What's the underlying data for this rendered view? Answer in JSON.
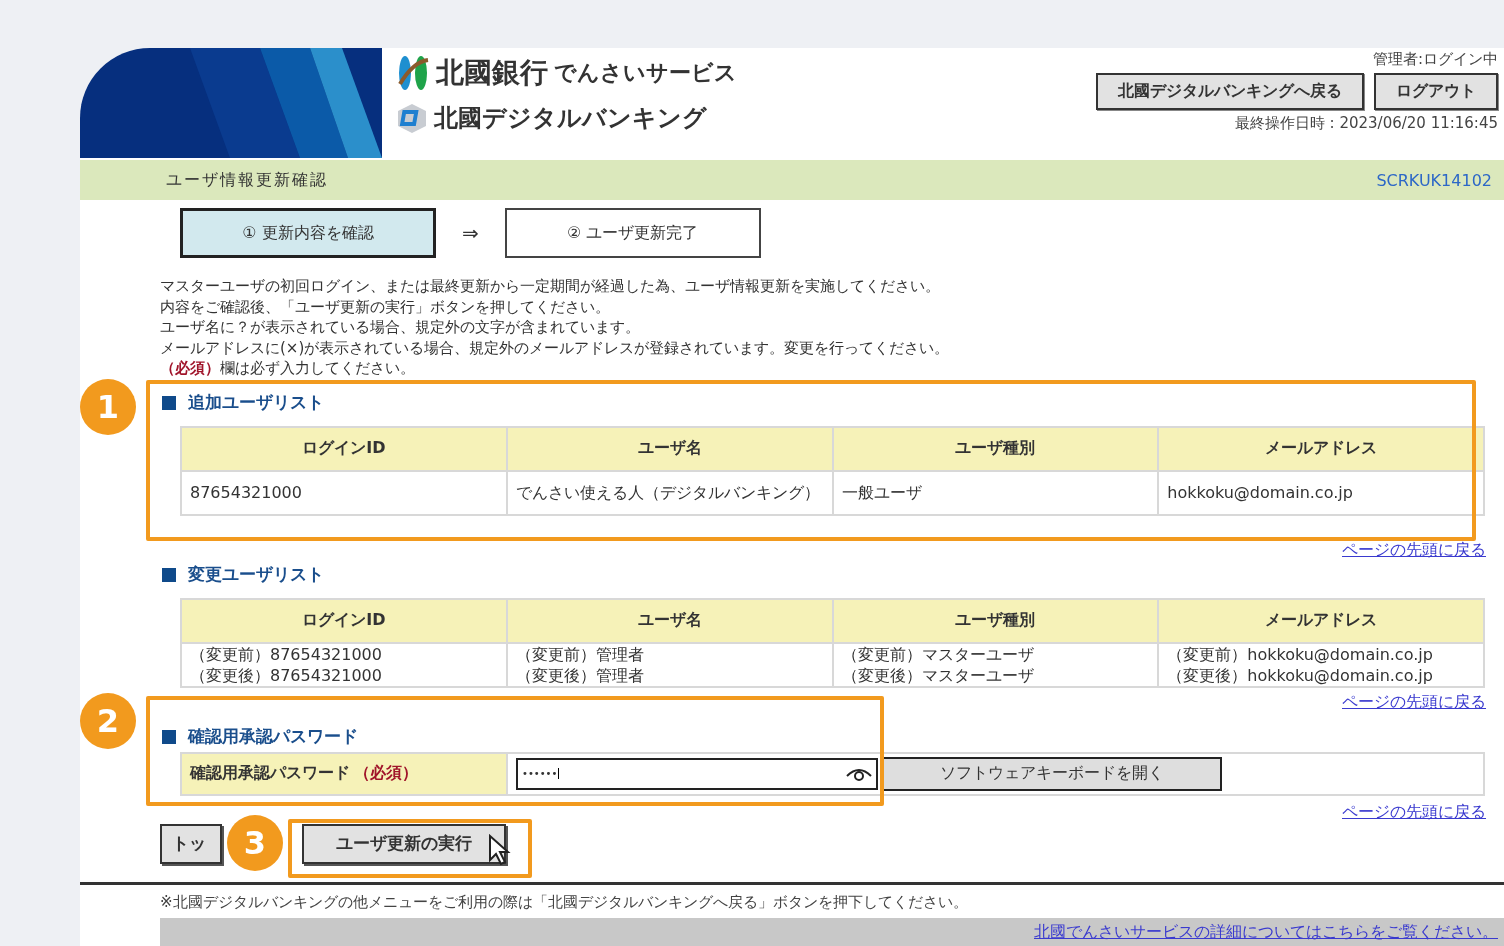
{
  "header": {
    "brand_name": "北國銀行",
    "service_name": "でんさいサービス",
    "sub_brand": "北國デジタルバンキング",
    "login_status": "管理者:ログイン中",
    "buttons": [
      "北國デジタルバンキングへ戻る",
      "ログアウト"
    ],
    "last_operation": "最終操作日時 : 2023/06/20 11:16:45"
  },
  "page_bar": {
    "title": "ユーザ情報更新確認",
    "screen_id": "SCRKUK14102"
  },
  "steps": [
    {
      "label": "① 更新内容を確認",
      "selected": true
    },
    {
      "label": "② ユーザ更新完了",
      "selected": false
    }
  ],
  "step_arrow": "⇒",
  "instructions": [
    "マスターユーザの初回ログイン、または最終更新から一定期間が経過した為、ユーザ情報更新を実施してください。",
    "内容をご確認後、「ユーザ更新の実行」ボタンを押してください。",
    "ユーザ名に？が表示されている場合、規定外の文字が含まれています。",
    "メールアドレスに(×)が表示されている場合、規定外のメールアドレスが登録されています。変更を行ってください。",
    "**（必須）**欄は必ず入力してください。"
  ],
  "sections": [
    {
      "title": "追加ユーザリスト",
      "columns": [
        "ログインID",
        "ユーザ名",
        "ユーザ種別",
        "メールアドレス"
      ],
      "rows": [
        [
          [
            "87654321000"
          ],
          [
            "でんさい使える人（デジタルバンキング）"
          ],
          [
            "一般ユーザ"
          ],
          [
            "hokkoku@domain.co.jp"
          ]
        ]
      ],
      "top_link": "ページの先頭に戻る"
    },
    {
      "title": "変更ユーザリスト",
      "columns": [
        "ログインID",
        "ユーザ名",
        "ユーザ種別",
        "メールアドレス"
      ],
      "rows": [
        [
          [
            "（変更前）87654321000",
            "（変更後）87654321000"
          ],
          [
            "（変更前）管理者",
            "（変更後）管理者"
          ],
          [
            "（変更前）マスターユーザ",
            "（変更後）マスターユーザ"
          ],
          [
            "（変更前）hokkoku@domain.co.jp",
            "（変更後）hokkoku@domain.co.jp"
          ]
        ]
      ],
      "top_link": "ページの先頭に戻る"
    }
  ],
  "password": {
    "title": "確認用承認パスワード",
    "label": "確認用承認パスワード",
    "required": "（必須）",
    "value": "••••••",
    "keyboard_button": "ソフトウェアキーボードを開く",
    "top_link": "ページの先頭に戻る"
  },
  "actions": [
    "トッ",
    "ユーザ更新の実行"
  ],
  "footer_note": "※北國デジタルバンキングの他メニューをご利用の際は「北國デジタルバンキングへ戻る」ボタンを押下してください。",
  "footer_link": "北國でんさいサービスの詳細についてはこちらをご覧ください。",
  "annotations": [
    "1",
    "2",
    "3"
  ]
}
